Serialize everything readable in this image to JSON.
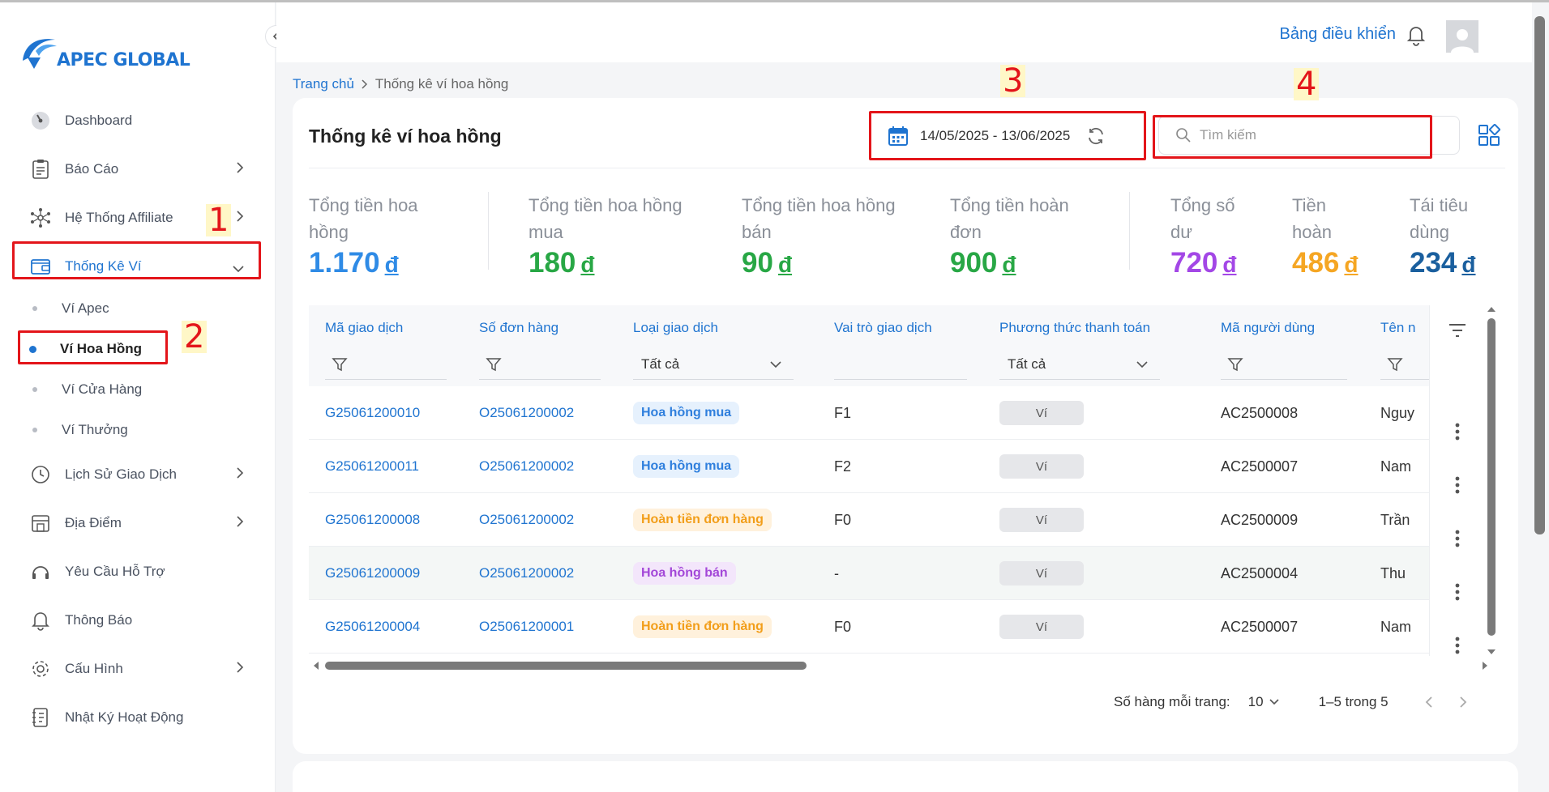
{
  "brand": {
    "name": "APEC GLOBAL"
  },
  "sidebar": {
    "items": [
      {
        "label": "Dashboard"
      },
      {
        "label": "Báo Cáo"
      },
      {
        "label": "Hệ Thống Affiliate"
      },
      {
        "label": "Thống Kê Ví"
      },
      {
        "label": "Lịch Sử Giao Dịch"
      },
      {
        "label": "Địa Điểm"
      },
      {
        "label": "Yêu Cầu Hỗ Trợ"
      },
      {
        "label": "Thông Báo"
      },
      {
        "label": "Cấu Hình"
      },
      {
        "label": "Nhật Ký Hoạt Động"
      }
    ],
    "sub_items": [
      {
        "label": "Ví Apec"
      },
      {
        "label": "Ví Hoa Hồng"
      },
      {
        "label": "Ví Cửa Hàng"
      },
      {
        "label": "Ví Thưởng"
      }
    ]
  },
  "annotations": [
    "1",
    "2",
    "3",
    "4"
  ],
  "header": {
    "dashboard_link": "Bảng điều khiển"
  },
  "breadcrumb": {
    "home": "Trang chủ",
    "current": "Thống kê ví hoa hồng"
  },
  "card": {
    "title": "Thống kê ví hoa hồng",
    "date_range": "14/05/2025 - 13/06/2025",
    "search_placeholder": "Tìm kiếm"
  },
  "stats": [
    {
      "label_1": "Tổng tiền hoa",
      "label_2": "hồng",
      "value": "1.170",
      "currency": "đ",
      "color": "#2f8be6"
    },
    {
      "label_1": "Tổng tiền hoa hồng",
      "label_2": "mua",
      "value": "180",
      "currency": "đ",
      "color": "#28a745"
    },
    {
      "label_1": "Tổng tiền hoa hồng",
      "label_2": "bán",
      "value": "90",
      "currency": "đ",
      "color": "#28a745"
    },
    {
      "label_1": "Tổng tiền hoàn",
      "label_2": "đơn",
      "value": "900",
      "currency": "đ",
      "color": "#28a745"
    },
    {
      "label_1": "Tổng số",
      "label_2": "dư",
      "value": "720",
      "currency": "đ",
      "color": "#a347e6"
    },
    {
      "label_1": "Tiền",
      "label_2": "hoàn",
      "value": "486",
      "currency": "đ",
      "color": "#f5a623"
    },
    {
      "label_1": "Tái tiêu",
      "label_2": "dùng",
      "value": "234",
      "currency": "đ",
      "color": "#1a5f9e"
    }
  ],
  "table": {
    "columns": [
      "Mã giao dịch",
      "Số đơn hàng",
      "Loại giao dịch",
      "Vai trò giao dịch",
      "Phương thức thanh toán",
      "Mã người dùng",
      "Tên n"
    ],
    "filter_all": "Tất cả",
    "rows": [
      {
        "id": "G25061200010",
        "order": "O25061200002",
        "type": "Hoa hồng mua",
        "role": "F1",
        "method": "Ví",
        "user": "AC2500008",
        "name": "Nguy"
      },
      {
        "id": "G25061200011",
        "order": "O25061200002",
        "type": "Hoa hồng mua",
        "role": "F2",
        "method": "Ví",
        "user": "AC2500007",
        "name": "Nam"
      },
      {
        "id": "G25061200008",
        "order": "O25061200002",
        "type": "Hoàn tiền đơn hàng",
        "role": "F0",
        "method": "Ví",
        "user": "AC2500009",
        "name": "Trần"
      },
      {
        "id": "G25061200009",
        "order": "O25061200002",
        "type": "Hoa hồng bán",
        "role": "-",
        "method": "Ví",
        "user": "AC2500004",
        "name": "Thu"
      },
      {
        "id": "G25061200004",
        "order": "O25061200001",
        "type": "Hoàn tiền đơn hàng",
        "role": "F0",
        "method": "Ví",
        "user": "AC2500007",
        "name": "Nam"
      }
    ]
  },
  "pagination": {
    "rows_per_page_label": "Số hàng mỗi trang:",
    "rows_per_page": "10",
    "range": "1–5 trong 5"
  }
}
